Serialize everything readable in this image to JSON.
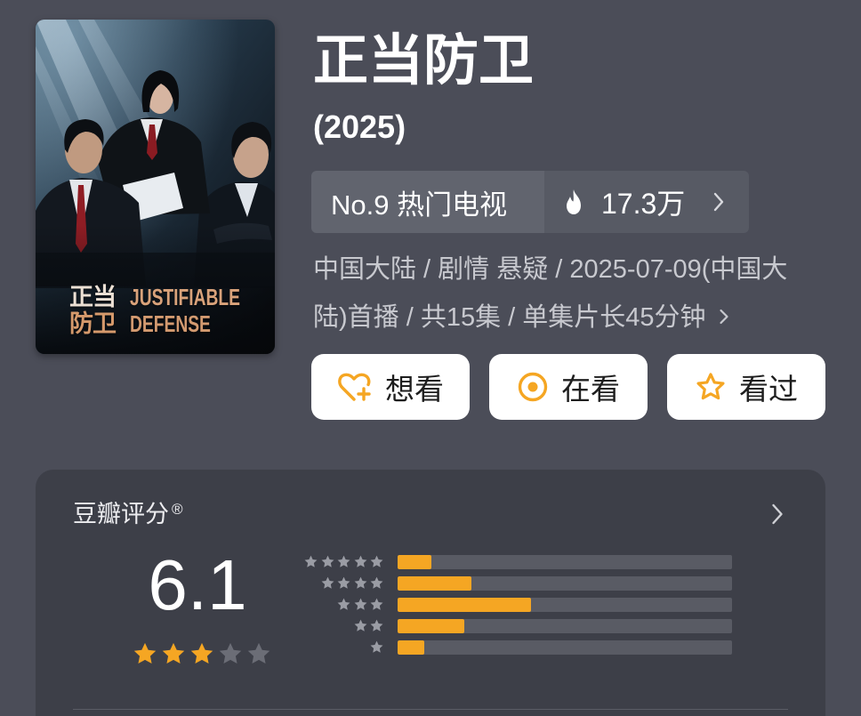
{
  "title": "正当防卫",
  "year": "(2025)",
  "poster": {
    "cn_line1": "正当",
    "en_line1": "JUSTIFIABLE",
    "cn_line2": "防卫",
    "en_line2": "DEFENSE"
  },
  "rank_badge": {
    "rank_text": "No.9 热门电视",
    "heat_icon": "fire-icon",
    "heat_value": "17.3万",
    "chevron_icon": "chevron-right-icon"
  },
  "meta": {
    "line1": "中国大陆 / 剧情 悬疑 / 2025-07-09(中国大",
    "line2": "陆)首播 / 共15集 / 单集片长45分钟",
    "chevron_icon": "chevron-right-icon"
  },
  "actions": [
    {
      "label": "想看",
      "icon": "heart-plus-icon"
    },
    {
      "label": "在看",
      "icon": "circle-dot-icon"
    },
    {
      "label": "看过",
      "icon": "star-outline-icon"
    }
  ],
  "rating": {
    "title": "豆瓣评分",
    "registered_mark": "®",
    "chevron_icon": "chevron-right-icon",
    "score": "6.1",
    "stars_filled": 3,
    "stars_total": 5,
    "distribution": [
      {
        "stars": 5,
        "percent": 10
      },
      {
        "stars": 4,
        "percent": 22
      },
      {
        "stars": 3,
        "percent": 40
      },
      {
        "stars": 2,
        "percent": 20
      },
      {
        "stars": 1,
        "percent": 8
      }
    ]
  },
  "colors": {
    "page_bg": "#4b4d58",
    "card_bg": "#3d3f48",
    "accent": "#f5a623",
    "star_empty": "#6b6d76",
    "bar_track": "#595b64"
  }
}
